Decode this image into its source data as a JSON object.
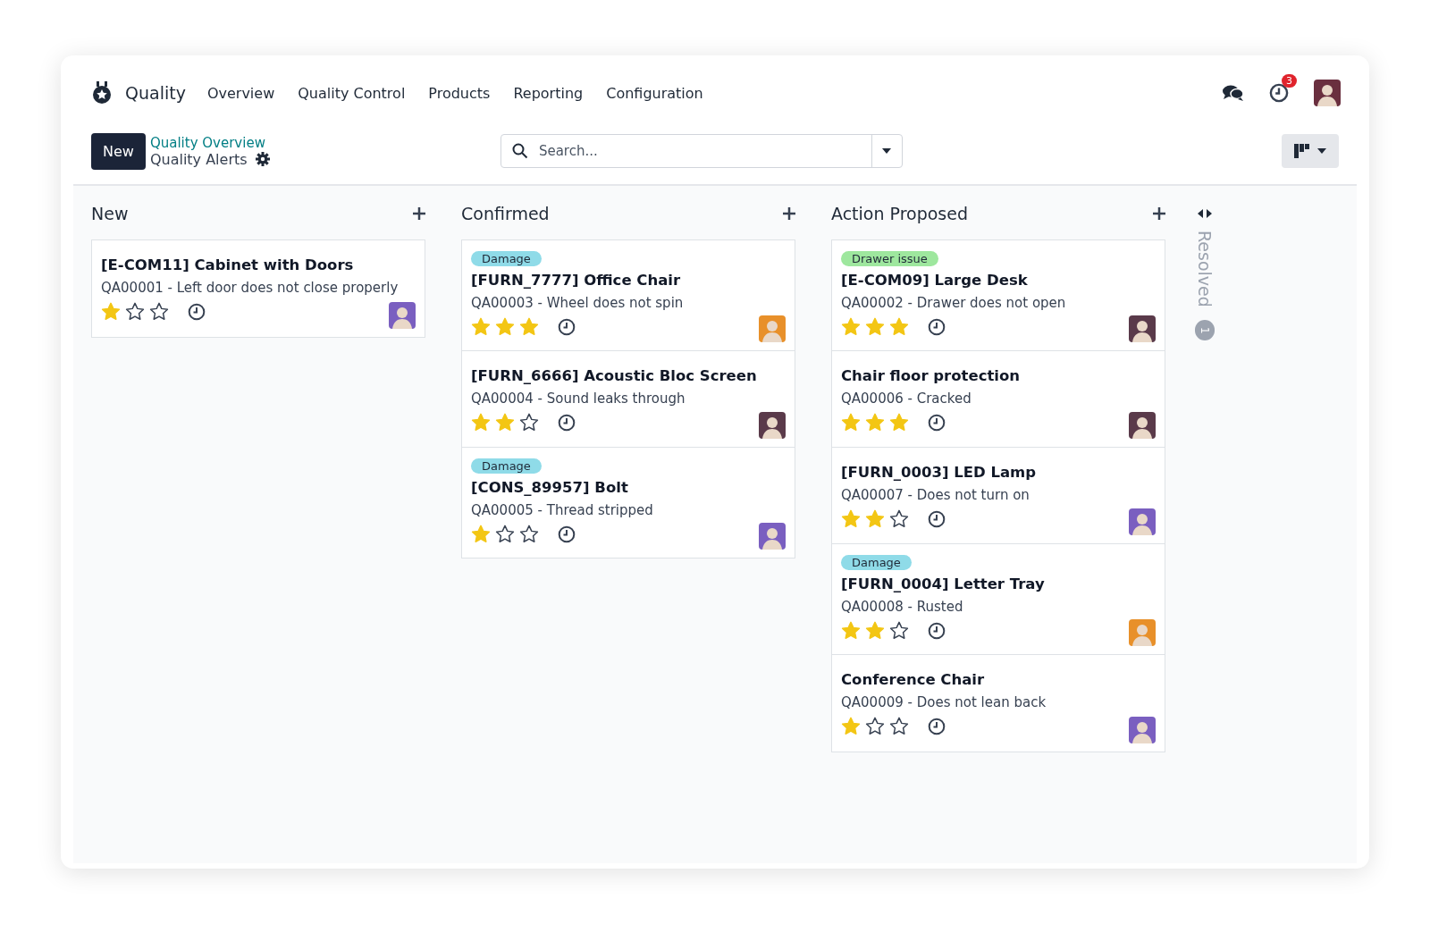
{
  "navbar": {
    "app_name": "Quality",
    "menu": [
      "Overview",
      "Quality Control",
      "Products",
      "Reporting",
      "Configuration"
    ],
    "activity_count": "3"
  },
  "control_panel": {
    "new_button": "New",
    "breadcrumb": "Quality Overview",
    "current": "Quality Alerts",
    "search": {
      "placeholder": "Search..."
    }
  },
  "columns": [
    {
      "title": "New",
      "cards": [
        {
          "title": "[E-COM11] Cabinet with Doors",
          "subtitle": "QA00001 - Left door does not close properly",
          "stars": 1,
          "avatar": {
            "color": "#7a5fc0"
          }
        }
      ]
    },
    {
      "title": "Confirmed",
      "cards": [
        {
          "tag": {
            "label": "Damage",
            "color": "#8fdbe8"
          },
          "title": "[FURN_7777] Office Chair",
          "subtitle": "QA00003 - Wheel does not spin",
          "stars": 3,
          "avatar": {
            "color": "#e8902a"
          }
        },
        {
          "title": "[FURN_6666] Acoustic Bloc Screen",
          "subtitle": "QA00004 - Sound leaks through",
          "stars": 2,
          "avatar": {
            "color": "#5a3a4a"
          }
        },
        {
          "tag": {
            "label": "Damage",
            "color": "#8fdbe8"
          },
          "title": "[CONS_89957] Bolt",
          "subtitle": "QA00005 - Thread stripped",
          "stars": 1,
          "avatar": {
            "color": "#7a5fc0"
          }
        }
      ]
    },
    {
      "title": "Action Proposed",
      "cards": [
        {
          "tag": {
            "label": "Drawer issue",
            "color": "#9ee79e"
          },
          "title": "[E-COM09] Large Desk",
          "subtitle": "QA00002 - Drawer does not open",
          "stars": 3,
          "avatar": {
            "color": "#5a3a4a"
          }
        },
        {
          "title": "Chair floor protection",
          "subtitle": "QA00006 - Cracked",
          "stars": 3,
          "avatar": {
            "color": "#5a3a4a"
          }
        },
        {
          "title": "[FURN_0003] LED Lamp",
          "subtitle": "QA00007 - Does not turn on",
          "stars": 2,
          "avatar": {
            "color": "#7a5fc0"
          }
        },
        {
          "tag": {
            "label": "Damage",
            "color": "#8fdbe8"
          },
          "title": "[FURN_0004] Letter Tray",
          "subtitle": "QA00008 - Rusted",
          "stars": 2,
          "avatar": {
            "color": "#e8902a"
          }
        },
        {
          "title": "Conference Chair",
          "subtitle": "QA00009 - Does not lean back",
          "stars": 1,
          "avatar": {
            "color": "#7a5fc0"
          }
        }
      ]
    }
  ],
  "folded_column": {
    "title": "Resolved",
    "count": "1"
  }
}
